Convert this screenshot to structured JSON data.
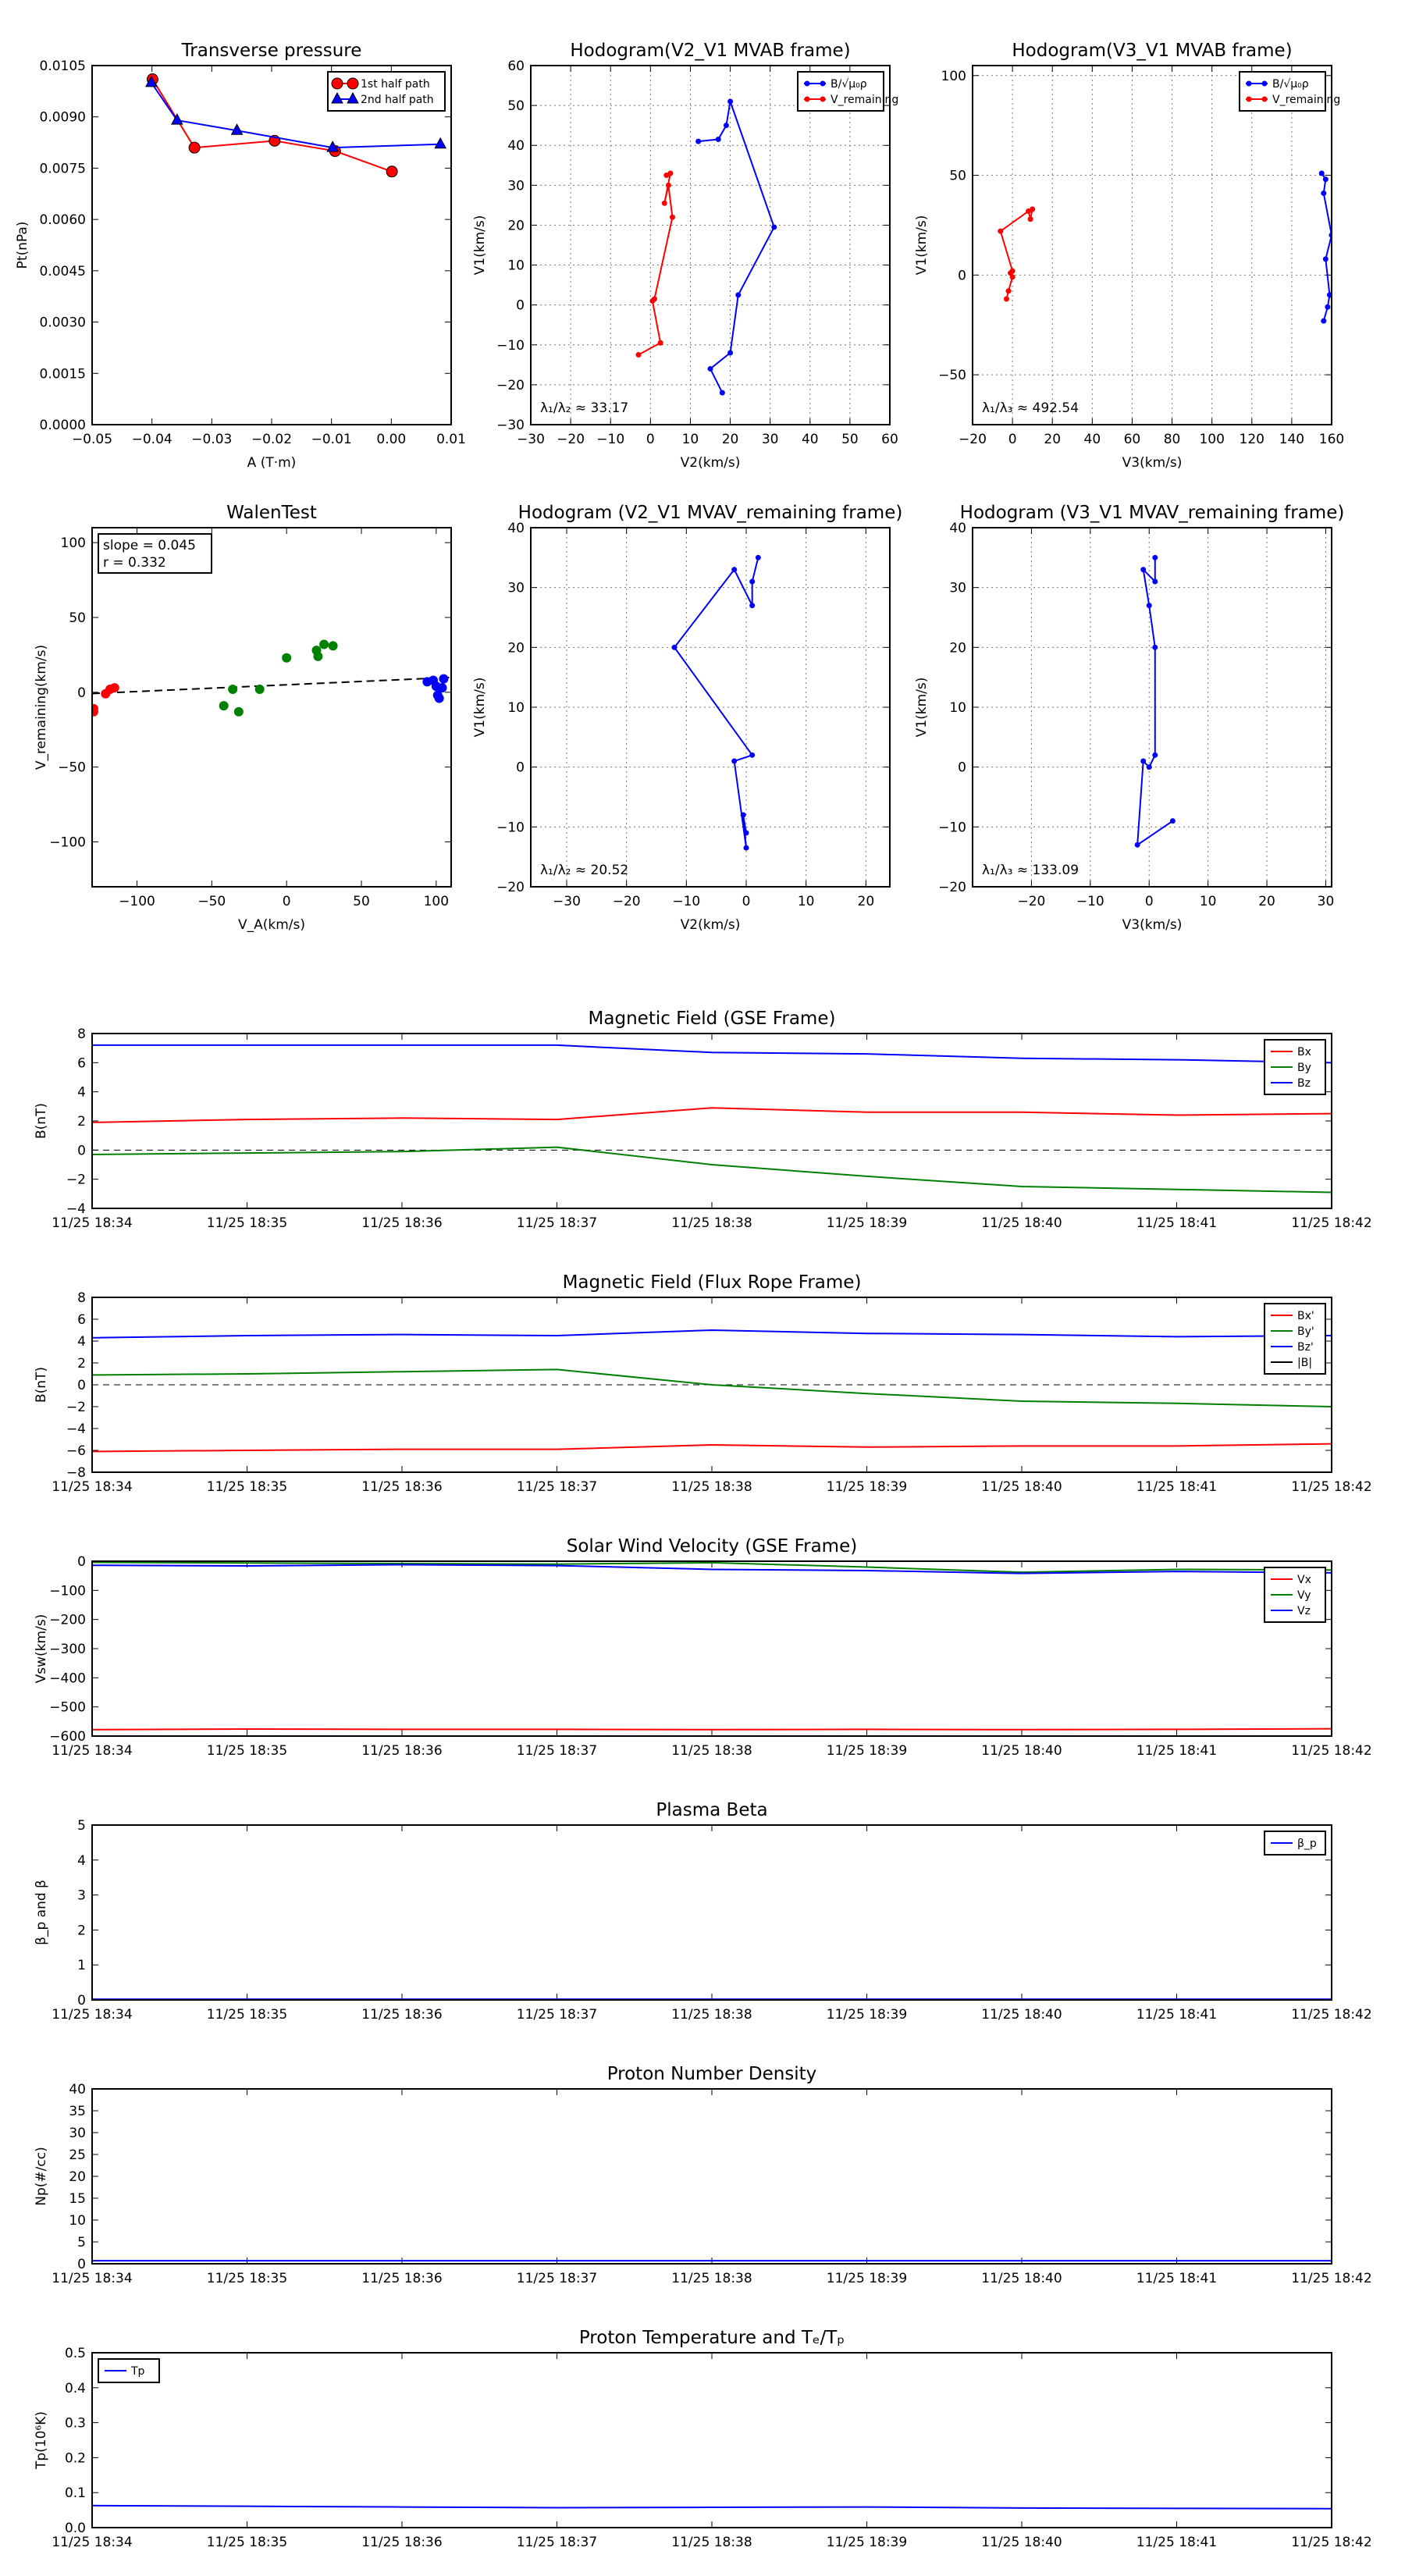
{
  "chart_data": [
    {
      "id": "tp",
      "type": "line",
      "title": "Transverse pressure",
      "xlabel": "A (T·m)",
      "ylabel": "Pt(nPa)",
      "xlim": [
        -0.05,
        0.01
      ],
      "ylim": [
        0,
        0.0105
      ],
      "xticks": [
        -0.05,
        -0.04,
        -0.03,
        -0.02,
        -0.01,
        0.0,
        0.01
      ],
      "xticklabels": [
        "−0.05",
        "−0.04",
        "−0.03",
        "−0.02",
        "−0.01",
        "0.00",
        "0.01"
      ],
      "yticks": [
        0,
        0.0015,
        0.003,
        0.0045,
        0.006,
        0.0075,
        0.009,
        0.0105
      ],
      "yticklabels": [
        "0.0000",
        "0.0015",
        "0.0030",
        "0.0045",
        "0.0060",
        "0.0075",
        "0.0090",
        "0.0105"
      ],
      "grid": false,
      "legend": "top-right",
      "series": [
        {
          "name": "1st half path",
          "color": "#ff0000",
          "marker": "circle",
          "x": [
            -0.0399,
            -0.0329,
            -0.0195,
            -0.0094,
            0.0001
          ],
          "y": [
            0.0101,
            0.0081,
            0.0083,
            0.008,
            0.0074
          ]
        },
        {
          "name": "2nd half path",
          "color": "#0000ff",
          "marker": "triangle",
          "x": [
            -0.0401,
            -0.0358,
            -0.0258,
            -0.0098,
            0.0082
          ],
          "y": [
            0.01,
            0.0089,
            0.0086,
            0.0081,
            0.0082
          ]
        }
      ]
    },
    {
      "id": "hodo1",
      "type": "line",
      "title": "Hodogram(V2_V1 MVAB frame)",
      "xlabel": "V2(km/s)",
      "ylabel": "V1(km/s)",
      "xlim": [
        -30,
        60
      ],
      "ylim": [
        -30,
        60
      ],
      "xticks": [
        -30,
        -20,
        -10,
        0,
        10,
        20,
        30,
        40,
        50,
        60
      ],
      "yticks": [
        -30,
        -20,
        -10,
        0,
        10,
        20,
        30,
        40,
        50,
        60
      ],
      "grid": true,
      "legend": "top-right",
      "annotation": "λ₁/λ₂ ≈ 33.17",
      "series": [
        {
          "name": "B/√μ₀ρ",
          "color": "#0000ff",
          "marker": "dot",
          "x": [
            12,
            17,
            19,
            20,
            31,
            22,
            20,
            15,
            18
          ],
          "y": [
            41,
            41.5,
            45,
            51,
            19.5,
            2.5,
            -12,
            -16,
            -22
          ]
        },
        {
          "name": "V_remaining",
          "color": "#ff0000",
          "marker": "dot",
          "x": [
            4,
            5,
            3.5,
            4.5,
            5.5,
            1,
            0.5,
            2.5,
            -3
          ],
          "y": [
            32.5,
            33,
            25.5,
            30,
            22,
            1.5,
            1,
            -9.5,
            -12.5
          ]
        }
      ]
    },
    {
      "id": "hodo2",
      "type": "line",
      "title": "Hodogram(V3_V1 MVAB frame)",
      "xlabel": "V3(km/s)",
      "ylabel": "V1(km/s)",
      "xlim": [
        -20,
        160
      ],
      "ylim": [
        -75,
        105
      ],
      "xticks": [
        -20,
        0,
        20,
        40,
        60,
        80,
        100,
        120,
        140,
        160
      ],
      "yticks": [
        -50,
        0,
        50,
        100
      ],
      "grid": true,
      "legend": "top-right",
      "annotation": "λ₁/λ₃ ≈ 492.54",
      "series": [
        {
          "name": "B/√μ₀ρ",
          "color": "#0000ff",
          "marker": "dot",
          "x": [
            155,
            157,
            156,
            160,
            157,
            159,
            158,
            156
          ],
          "y": [
            51,
            48,
            41,
            20,
            8,
            -10,
            -16,
            -23
          ]
        },
        {
          "name": "V_remaining",
          "color": "#ff0000",
          "marker": "dot",
          "x": [
            10,
            9,
            8,
            -6,
            0,
            -1,
            0,
            -2,
            -3
          ],
          "y": [
            33,
            28,
            32,
            22,
            2,
            1,
            -1,
            -8,
            -12
          ]
        }
      ]
    },
    {
      "id": "walen",
      "type": "scatter",
      "title": "WalenTest",
      "xlabel": "V_A(km/s)",
      "ylabel": "V_remaining(km/s)",
      "xlim": [
        -130,
        110
      ],
      "ylim": [
        -130,
        110
      ],
      "xticks": [
        -100,
        -50,
        0,
        50,
        100
      ],
      "yticks": [
        -100,
        -50,
        0,
        50,
        100
      ],
      "grid": false,
      "annotation_lines": [
        "slope = 0.045",
        "r = 0.332"
      ],
      "fit_line": {
        "slope": 0.045,
        "intercept": 5,
        "color": "#000000"
      },
      "series": [
        {
          "name": "",
          "color": "#ff0000",
          "x": [
            -129,
            -129,
            -121,
            -118,
            -115
          ],
          "y": [
            -11,
            -13,
            -1,
            2,
            3
          ]
        },
        {
          "name": "",
          "color": "#008000",
          "x": [
            -42,
            -36,
            -32,
            -18,
            0,
            20,
            21,
            25,
            31
          ],
          "y": [
            -9,
            2,
            -13,
            2,
            23,
            28,
            24,
            32,
            31
          ]
        },
        {
          "name": "",
          "color": "#0000ff",
          "x": [
            94,
            98,
            100,
            101,
            102,
            104,
            105
          ],
          "y": [
            7,
            8,
            4,
            -2,
            -4,
            3,
            9
          ]
        }
      ]
    },
    {
      "id": "hodo3",
      "type": "line",
      "title": "Hodogram (V2_V1 MVAV_remaining frame)",
      "xlabel": "V2(km/s)",
      "ylabel": "V1(km/s)",
      "xlim": [
        -36,
        24
      ],
      "ylim": [
        -20,
        40
      ],
      "xticks": [
        -30,
        -20,
        -10,
        0,
        10,
        20
      ],
      "yticks": [
        -20,
        -10,
        0,
        10,
        20,
        30,
        40
      ],
      "grid": true,
      "annotation": "λ₁/λ₂ ≈ 20.52",
      "series": [
        {
          "name": "",
          "color": "#0000ff",
          "marker": "dot",
          "x": [
            2,
            1,
            1,
            -2,
            -12,
            1,
            -2,
            0,
            -0.5,
            0
          ],
          "y": [
            35,
            31,
            27,
            33,
            20,
            2,
            1,
            -13.5,
            -8,
            -11
          ]
        }
      ]
    },
    {
      "id": "hodo4",
      "type": "line",
      "title": "Hodogram (V3_V1 MVAV_remaining frame)",
      "xlabel": "V3(km/s)",
      "ylabel": "V1(km/s)",
      "xlim": [
        -30,
        31
      ],
      "ylim": [
        -20,
        40
      ],
      "xticks": [
        -20,
        -10,
        0,
        10,
        20,
        30
      ],
      "yticks": [
        -20,
        -10,
        0,
        10,
        20,
        30,
        40
      ],
      "grid": true,
      "annotation": "λ₁/λ₃ ≈ 133.09",
      "series": [
        {
          "name": "",
          "color": "#0000ff",
          "marker": "dot",
          "x": [
            1,
            1,
            -1,
            0,
            1,
            1,
            0,
            -1,
            -2,
            4
          ],
          "y": [
            35,
            31,
            33,
            27,
            20,
            2,
            0,
            1,
            -13,
            -9
          ]
        }
      ]
    },
    {
      "id": "bgse",
      "type": "line",
      "title": "Magnetic Field (GSE Frame)",
      "ylabel": "B(nT)",
      "ylim": [
        -4,
        8
      ],
      "yticks": [
        -4,
        -2,
        0,
        2,
        4,
        6,
        8
      ],
      "x": [
        "11/25 18:34",
        "11/25 18:35",
        "11/25 18:36",
        "11/25 18:37",
        "11/25 18:38",
        "11/25 18:39",
        "11/25 18:40",
        "11/25 18:41",
        "11/25 18:42"
      ],
      "zero_line": true,
      "legend": "top-right",
      "series": [
        {
          "name": "Bx",
          "color": "#ff0000",
          "values": [
            1.9,
            2.1,
            2.2,
            2.1,
            2.9,
            2.6,
            2.6,
            2.4,
            2.5
          ]
        },
        {
          "name": "By",
          "color": "#008000",
          "values": [
            -0.3,
            -0.2,
            -0.1,
            0.2,
            -1.0,
            -1.8,
            -2.5,
            -2.7,
            -2.9
          ]
        },
        {
          "name": "Bz",
          "color": "#0000ff",
          "values": [
            7.2,
            7.2,
            7.2,
            7.2,
            6.7,
            6.6,
            6.3,
            6.2,
            6.0
          ]
        }
      ]
    },
    {
      "id": "bfr",
      "type": "line",
      "title": "Magnetic Field (Flux Rope Frame)",
      "ylabel": "B(nT)",
      "ylim": [
        -8,
        8
      ],
      "yticks": [
        -8,
        -6,
        -4,
        -2,
        0,
        2,
        4,
        6,
        8
      ],
      "x": [
        "11/25 18:34",
        "11/25 18:35",
        "11/25 18:36",
        "11/25 18:37",
        "11/25 18:38",
        "11/25 18:39",
        "11/25 18:40",
        "11/25 18:41",
        "11/25 18:42"
      ],
      "zero_line": true,
      "legend": "top-right",
      "series": [
        {
          "name": "Bx'",
          "color": "#ff0000",
          "values": [
            -6.1,
            -6.0,
            -5.9,
            -5.9,
            -5.5,
            -5.7,
            -5.6,
            -5.6,
            -5.4
          ]
        },
        {
          "name": "By'",
          "color": "#008000",
          "values": [
            0.9,
            1.0,
            1.2,
            1.4,
            0.0,
            -0.8,
            -1.5,
            -1.7,
            -2.0
          ]
        },
        {
          "name": "Bz'",
          "color": "#0000ff",
          "values": [
            4.3,
            4.5,
            4.6,
            4.5,
            5.0,
            4.7,
            4.6,
            4.4,
            4.5
          ]
        },
        {
          "name": "|B|",
          "color": "#000000",
          "values": []
        }
      ]
    },
    {
      "id": "vsw",
      "type": "line",
      "title": "Solar Wind Velocity (GSE Frame)",
      "ylabel": "Vsw(km/s)",
      "ylim": [
        -600,
        0
      ],
      "yticks": [
        -600,
        -500,
        -400,
        -300,
        -200,
        -100,
        0
      ],
      "yticklabels": [
        "−600",
        "−500",
        "−400",
        "−300",
        "−200",
        "−100",
        "0"
      ],
      "x": [
        "11/25 18:34",
        "11/25 18:35",
        "11/25 18:36",
        "11/25 18:37",
        "11/25 18:38",
        "11/25 18:39",
        "11/25 18:40",
        "11/25 18:41",
        "11/25 18:42"
      ],
      "legend": "top-right",
      "series": [
        {
          "name": "Vx",
          "color": "#ff0000",
          "values": [
            -578,
            -576,
            -577,
            -577,
            -578,
            -577,
            -578,
            -577,
            -575
          ]
        },
        {
          "name": "Vy",
          "color": "#008000",
          "values": [
            -4,
            -6,
            -8,
            -10,
            -5,
            -20,
            -38,
            -28,
            -30
          ]
        },
        {
          "name": "Vz",
          "color": "#0000ff",
          "values": [
            -14,
            -16,
            -12,
            -15,
            -28,
            -32,
            -42,
            -35,
            -40
          ]
        }
      ]
    },
    {
      "id": "beta",
      "type": "line",
      "title": "Plasma Beta",
      "ylabel": "β_p and β",
      "ylim": [
        0,
        5
      ],
      "yticks": [
        0,
        1,
        2,
        3,
        4,
        5
      ],
      "x": [
        "11/25 18:34",
        "11/25 18:35",
        "11/25 18:36",
        "11/25 18:37",
        "11/25 18:38",
        "11/25 18:39",
        "11/25 18:40",
        "11/25 18:41",
        "11/25 18:42"
      ],
      "legend": "top-right",
      "series": [
        {
          "name": "β_p",
          "color": "#0000ff",
          "values": [
            0.02,
            0.02,
            0.02,
            0.02,
            0.02,
            0.02,
            0.02,
            0.02,
            0.02
          ]
        }
      ]
    },
    {
      "id": "np",
      "type": "line",
      "title": "Proton Number Density",
      "ylabel": "Np(#/cc)",
      "ylim": [
        0,
        40
      ],
      "yticks": [
        0,
        5,
        10,
        15,
        20,
        25,
        30,
        35,
        40
      ],
      "x": [
        "11/25 18:34",
        "11/25 18:35",
        "11/25 18:36",
        "11/25 18:37",
        "11/25 18:38",
        "11/25 18:39",
        "11/25 18:40",
        "11/25 18:41",
        "11/25 18:42"
      ],
      "series": [
        {
          "name": "",
          "color": "#0000ff",
          "values": [
            0.7,
            0.7,
            0.7,
            0.7,
            0.7,
            0.7,
            0.7,
            0.7,
            0.7
          ]
        }
      ]
    },
    {
      "id": "tp2",
      "type": "line",
      "title": "Proton Temperature and Tₑ/Tₚ",
      "ylabel": "Tp(10⁶K)",
      "ylim": [
        0,
        0.5
      ],
      "yticks": [
        0,
        0.1,
        0.2,
        0.3,
        0.4,
        0.5
      ],
      "yticklabels": [
        "0.0",
        "0.1",
        "0.2",
        "0.3",
        "0.4",
        "0.5"
      ],
      "x": [
        "11/25 18:34",
        "11/25 18:35",
        "11/25 18:36",
        "11/25 18:37",
        "11/25 18:38",
        "11/25 18:39",
        "11/25 18:40",
        "11/25 18:41",
        "11/25 18:42"
      ],
      "legend": "top-left",
      "series": [
        {
          "name": "Tp",
          "color": "#0000ff",
          "values": [
            0.063,
            0.061,
            0.059,
            0.057,
            0.058,
            0.059,
            0.056,
            0.055,
            0.054
          ]
        }
      ]
    }
  ]
}
